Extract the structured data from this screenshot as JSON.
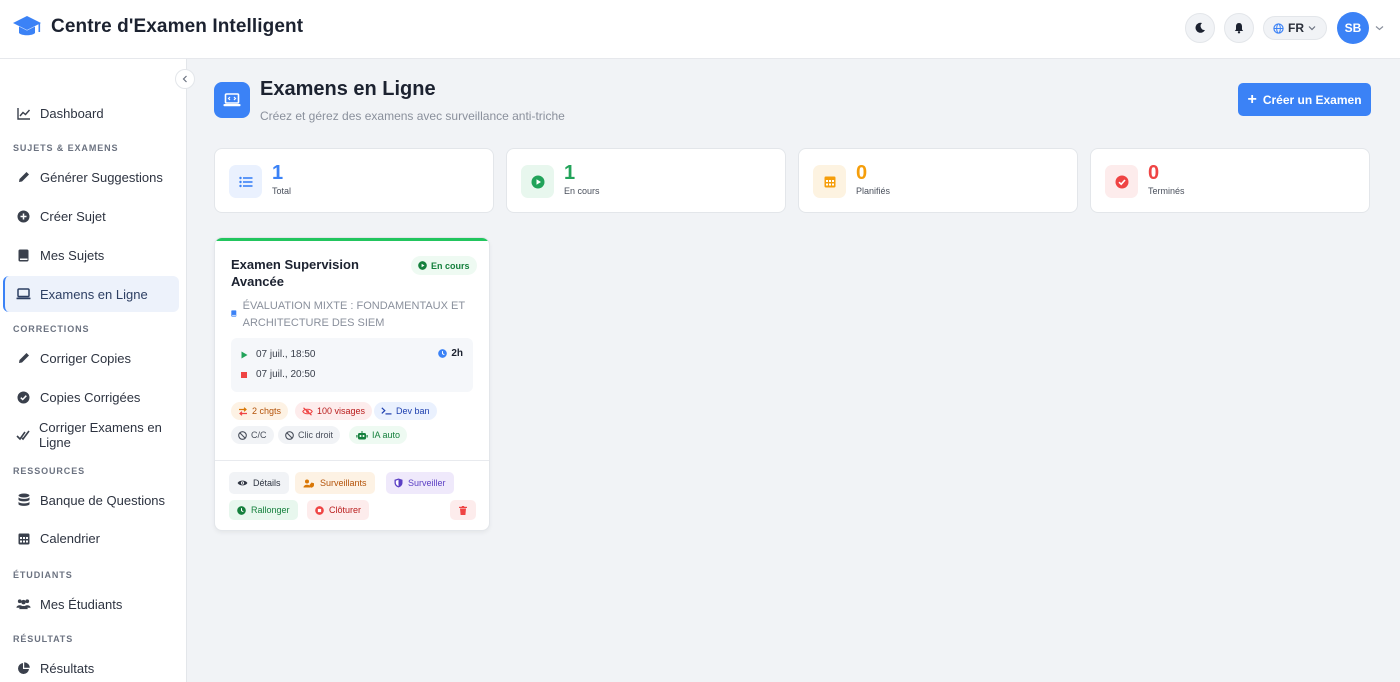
{
  "app": {
    "title": "Centre d'Examen Intelligent",
    "language": "FR",
    "user_initials": "SB"
  },
  "sidebar": {
    "items": [
      {
        "label": "Dashboard",
        "icon": "chart-line-icon"
      },
      {
        "label": "Générer Suggestions",
        "icon": "pencil-icon"
      },
      {
        "label": "Créer Sujet",
        "icon": "plus-circle-icon"
      },
      {
        "label": "Mes Sujets",
        "icon": "book-icon"
      },
      {
        "label": "Examens en Ligne",
        "icon": "laptop-icon",
        "active": true
      },
      {
        "label": "Corriger Copies",
        "icon": "pen-icon"
      },
      {
        "label": "Copies Corrigées",
        "icon": "check-circle-icon"
      },
      {
        "label": "Corriger Examens en Ligne",
        "icon": "double-check-icon"
      },
      {
        "label": "Banque de Questions",
        "icon": "database-icon"
      },
      {
        "label": "Calendrier",
        "icon": "calendar-icon"
      },
      {
        "label": "Mes Étudiants",
        "icon": "users-icon"
      },
      {
        "label": "Résultats",
        "icon": "pie-chart-icon"
      }
    ],
    "sections": [
      "SUJETS & EXAMENS",
      "CORRECTIONS",
      "RESSOURCES",
      "ÉTUDIANTS",
      "RÉSULTATS"
    ]
  },
  "page": {
    "title": "Examens en Ligne",
    "subtitle": "Créez et gérez des examens avec surveillance anti-triche",
    "create_button": "Créer un Examen"
  },
  "stats": [
    {
      "value": "1",
      "label": "Total",
      "icon": "list-icon",
      "color": "#3b82f6"
    },
    {
      "value": "1",
      "label": "En cours",
      "icon": "play-circle-icon",
      "color": "#22a35a"
    },
    {
      "value": "0",
      "label": "Planifiés",
      "icon": "calendar-icon",
      "color": "#f59e0b"
    },
    {
      "value": "0",
      "label": "Terminés",
      "icon": "check-circle-icon",
      "color": "#ef4444"
    }
  ],
  "exam": {
    "title": "Examen Supervision Avancée",
    "status": "En cours",
    "subject": "ÉVALUATION MIXTE : FONDAMENTAUX ET ARCHITECTURE DES SIEM",
    "start": "07 juil., 18:50",
    "end": "07 juil., 20:50",
    "duration": "2h",
    "tags": [
      {
        "label": "2 chgts",
        "icon": "swap-icon"
      },
      {
        "label": "100 visages",
        "icon": "eye-slash-icon"
      },
      {
        "label": "Dev ban",
        "icon": "terminal-icon"
      },
      {
        "label": "C/C",
        "icon": "ban-icon"
      },
      {
        "label": "Clic droit",
        "icon": "ban-icon"
      },
      {
        "label": "IA auto",
        "icon": "robot-icon"
      }
    ],
    "actions": {
      "details": "Détails",
      "surveillants": "Surveillants",
      "surveiller": "Surveiller",
      "rallonger": "Rallonger",
      "cloturer": "Clôturer"
    }
  }
}
